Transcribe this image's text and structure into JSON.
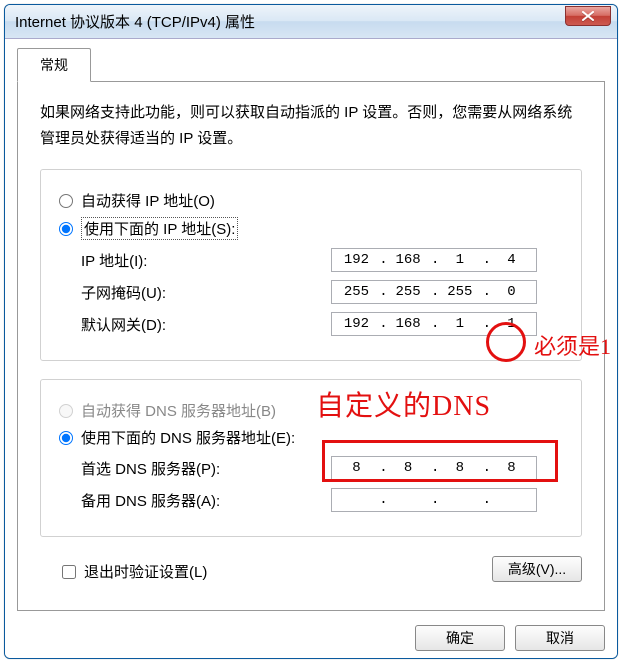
{
  "window": {
    "title": "Internet 协议版本 4 (TCP/IPv4) 属性"
  },
  "tabs": {
    "general": "常规"
  },
  "description": "如果网络支持此功能，则可以获取自动指派的 IP 设置。否则，您需要从网络系统管理员处获得适当的 IP 设置。",
  "ipGroup": {
    "autoRadio": "自动获得 IP 地址(O)",
    "manualRadio": "使用下面的 IP 地址(S):",
    "ipLabel": "IP 地址(I):",
    "subnetLabel": "子网掩码(U):",
    "gatewayLabel": "默认网关(D):",
    "ip": {
      "o1": "192",
      "o2": "168",
      "o3": "1",
      "o4": "4"
    },
    "subnet": {
      "o1": "255",
      "o2": "255",
      "o3": "255",
      "o4": "0"
    },
    "gateway": {
      "o1": "192",
      "o2": "168",
      "o3": "1",
      "o4": "1"
    }
  },
  "dnsGroup": {
    "autoRadio": "自动获得 DNS 服务器地址(B)",
    "manualRadio": "使用下面的 DNS 服务器地址(E):",
    "primaryLabel": "首选 DNS 服务器(P):",
    "altLabel": "备用 DNS 服务器(A):",
    "primary": {
      "o1": "8",
      "o2": "8",
      "o3": "8",
      "o4": "8"
    },
    "alt": {
      "o1": "",
      "o2": "",
      "o3": "",
      "o4": ""
    }
  },
  "validateCheck": "退出时验证设置(L)",
  "buttons": {
    "advanced": "高级(V)...",
    "ok": "确定",
    "cancel": "取消"
  },
  "annotations": {
    "mustBe1": "必须是1",
    "customDns": "自定义的DNS"
  }
}
